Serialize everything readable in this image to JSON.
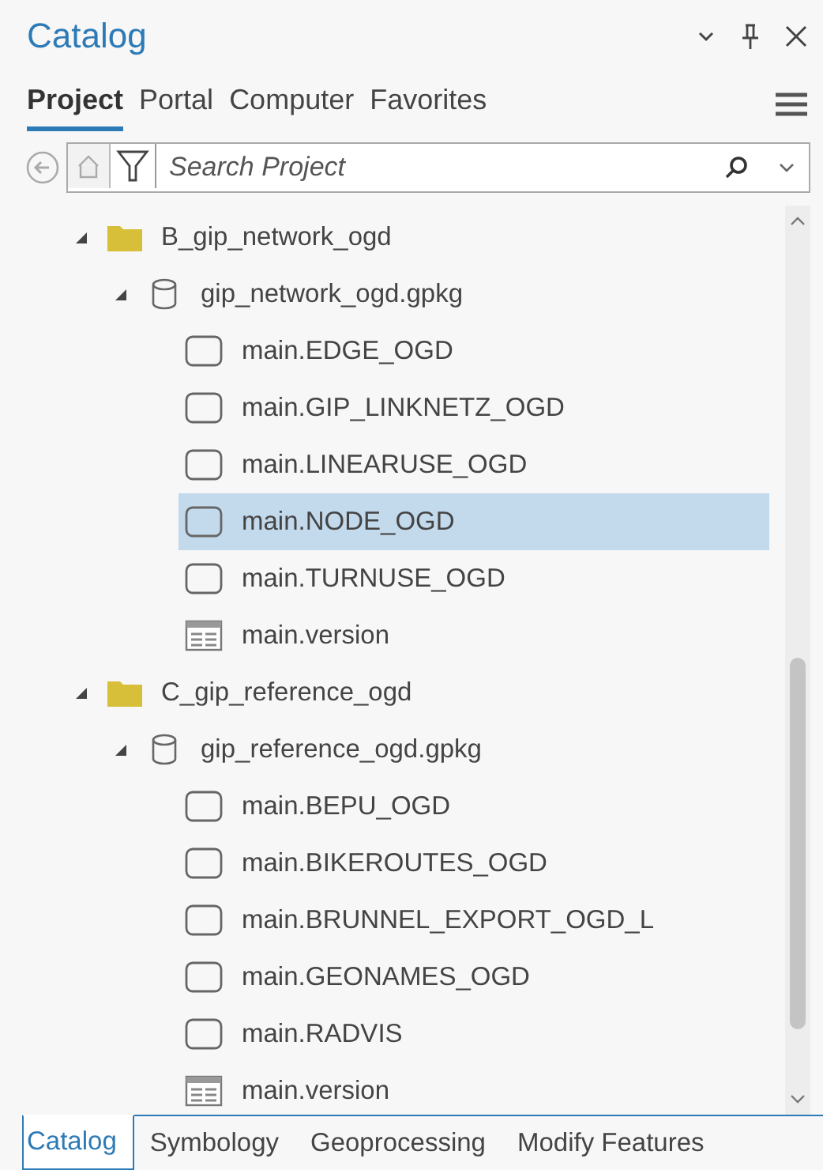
{
  "window": {
    "title": "Catalog"
  },
  "tabs": [
    {
      "label": "Project",
      "selected": true
    },
    {
      "label": "Portal",
      "selected": false
    },
    {
      "label": "Computer",
      "selected": false
    },
    {
      "label": "Favorites",
      "selected": false
    }
  ],
  "search": {
    "placeholder": "Search Project"
  },
  "tree": [
    {
      "label": "B_gip_network_ogd",
      "kind": "folder",
      "expanded": true,
      "children": [
        {
          "label": "gip_network_ogd.gpkg",
          "kind": "database",
          "expanded": true,
          "children": [
            {
              "label": "main.EDGE_OGD",
              "kind": "feature",
              "selected": false
            },
            {
              "label": "main.GIP_LINKNETZ_OGD",
              "kind": "feature",
              "selected": false
            },
            {
              "label": "main.LINEARUSE_OGD",
              "kind": "feature",
              "selected": false
            },
            {
              "label": "main.NODE_OGD",
              "kind": "feature",
              "selected": true
            },
            {
              "label": "main.TURNUSE_OGD",
              "kind": "feature",
              "selected": false
            },
            {
              "label": "main.version",
              "kind": "table",
              "selected": false
            }
          ]
        }
      ]
    },
    {
      "label": "C_gip_reference_ogd",
      "kind": "folder",
      "expanded": true,
      "children": [
        {
          "label": "gip_reference_ogd.gpkg",
          "kind": "database",
          "expanded": true,
          "children": [
            {
              "label": "main.BEPU_OGD",
              "kind": "feature",
              "selected": false
            },
            {
              "label": "main.BIKEROUTES_OGD",
              "kind": "feature",
              "selected": false
            },
            {
              "label": "main.BRUNNEL_EXPORT_OGD_L",
              "kind": "feature",
              "selected": false
            },
            {
              "label": "main.GEONAMES_OGD",
              "kind": "feature",
              "selected": false
            },
            {
              "label": "main.RADVIS",
              "kind": "feature",
              "selected": false
            },
            {
              "label": "main.version",
              "kind": "table",
              "selected": false
            }
          ]
        }
      ]
    }
  ],
  "bottom_tabs": [
    {
      "label": "Catalog",
      "selected": true
    },
    {
      "label": "Symbology",
      "selected": false
    },
    {
      "label": "Geoprocessing",
      "selected": false
    },
    {
      "label": "Modify Features",
      "selected": false
    }
  ]
}
